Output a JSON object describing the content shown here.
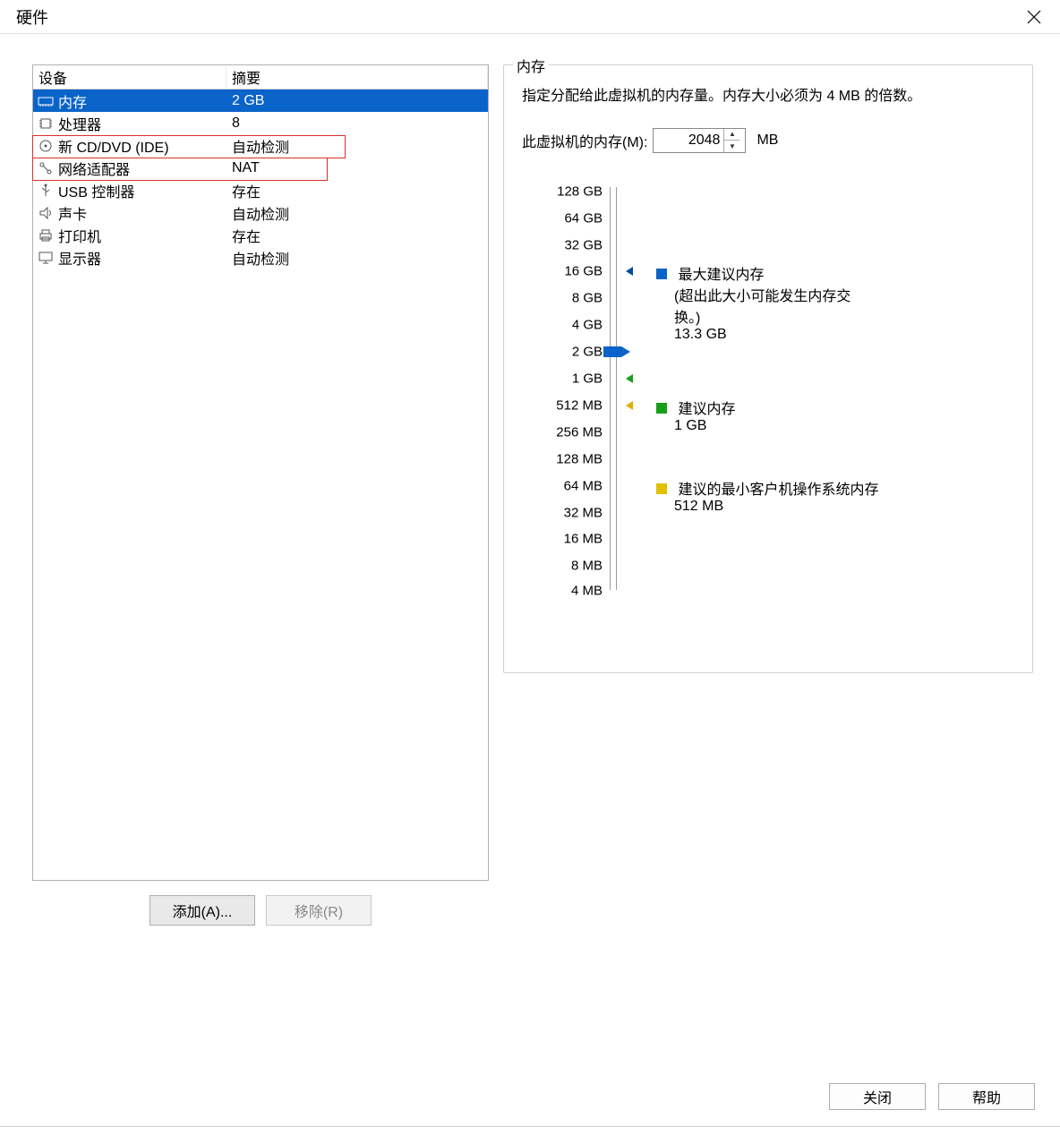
{
  "window": {
    "title": "硬件"
  },
  "device_table": {
    "headers": {
      "c1": "设备",
      "c2": "摘要"
    },
    "rows": [
      {
        "name": "内存",
        "summary": "2 GB",
        "selected": true
      },
      {
        "name": "处理器",
        "summary": "8"
      },
      {
        "name": "新 CD/DVD (IDE)",
        "summary": "自动检测",
        "highlight": true
      },
      {
        "name": "网络适配器",
        "summary": "NAT",
        "highlight": true
      },
      {
        "name": "USB 控制器",
        "summary": "存在"
      },
      {
        "name": "声卡",
        "summary": "自动检测"
      },
      {
        "name": "打印机",
        "summary": "存在"
      },
      {
        "name": "显示器",
        "summary": "自动检测"
      }
    ]
  },
  "buttons": {
    "add": "添加(A)...",
    "remove": "移除(R)",
    "close": "关闭",
    "help": "帮助"
  },
  "memory_panel": {
    "group_title": "内存",
    "desc": "指定分配给此虚拟机的内存量。内存大小必须为 4 MB 的倍数。",
    "label": "此虚拟机的内存(M):",
    "value": "2048",
    "unit": "MB",
    "ticks": [
      "128 GB",
      "64 GB",
      "32 GB",
      "16 GB",
      "8 GB",
      "4 GB",
      "2 GB",
      "1 GB",
      "512 MB",
      "256 MB",
      "128 MB",
      "64 MB",
      "32 MB",
      "16 MB",
      "8 MB",
      "4 MB"
    ],
    "legend": {
      "max": {
        "title": "最大建议内存",
        "note": "(超出此大小可能发生内存交换。)",
        "value": "13.3 GB"
      },
      "rec": {
        "title": "建议内存",
        "value": "1 GB"
      },
      "min": {
        "title": "建议的最小客户机操作系统内存",
        "value": "512 MB"
      }
    }
  }
}
